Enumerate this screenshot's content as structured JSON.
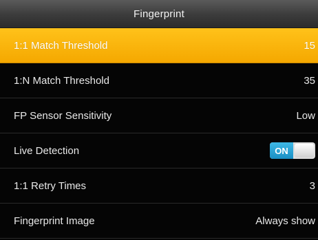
{
  "header": {
    "title": "Fingerprint"
  },
  "settings": [
    {
      "label": "1:1 Match Threshold",
      "value": "15",
      "selected": true
    },
    {
      "label": "1:N Match Threshold",
      "value": "35"
    },
    {
      "label": "FP Sensor Sensitivity",
      "value": "Low"
    },
    {
      "label": "Live Detection",
      "toggle": "ON"
    },
    {
      "label": "1:1 Retry Times",
      "value": "3"
    },
    {
      "label": "Fingerprint Image",
      "value": "Always show"
    }
  ],
  "colors": {
    "selected_bg": "#f7b10e",
    "toggle_on": "#2aa6d8"
  }
}
